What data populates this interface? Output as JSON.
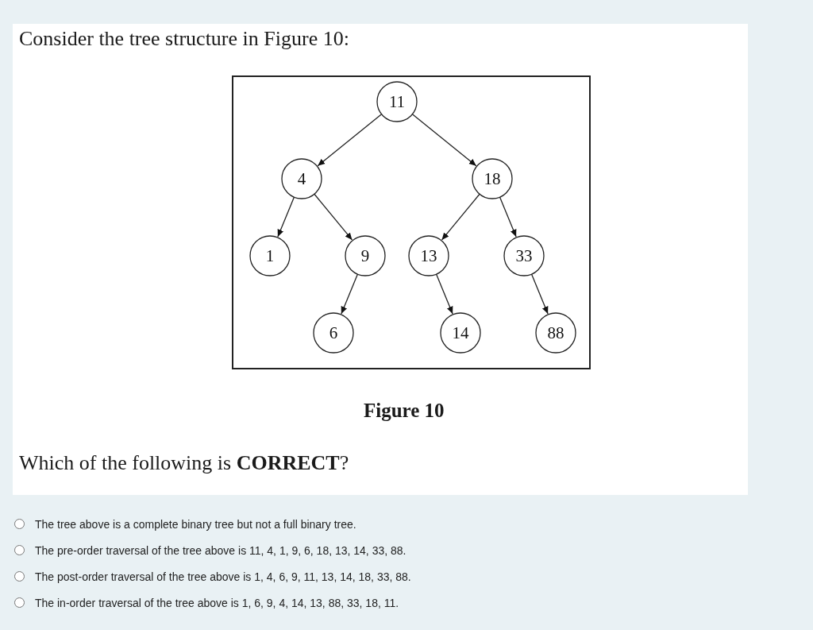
{
  "question": {
    "intro": "Consider the tree structure in Figure 10:",
    "figure": {
      "tree": {
        "label": "11",
        "children": [
          {
            "label": "4",
            "kind": "left",
            "children": [
              {
                "label": "1",
                "kind": "left"
              },
              {
                "label": "9",
                "kind": "right",
                "children": [
                  {
                    "label": "6",
                    "kind": "left"
                  }
                ]
              }
            ]
          },
          {
            "label": "18",
            "kind": "right",
            "children": [
              {
                "label": "13",
                "kind": "left",
                "children": [
                  {
                    "label": "14",
                    "kind": "right"
                  }
                ]
              },
              {
                "label": "33",
                "kind": "right",
                "children": [
                  {
                    "label": "88",
                    "kind": "right"
                  }
                ]
              }
            ]
          }
        ]
      },
      "caption": "Figure 10"
    },
    "prompt": "Which of the following is **CORRECT**?"
  },
  "options": [
    {
      "label": "The tree above is a complete binary tree but not a full binary tree.",
      "selected": false
    },
    {
      "label": "The pre-order traversal of the tree above is 11, 4, 1, 9, 6, 18, 13, 14, 33, 88.",
      "selected": false
    },
    {
      "label": "The post-order traversal of the tree above is 1, 4, 6, 9, 11, 13, 14, 18, 33, 88.",
      "selected": false
    },
    {
      "label": "The in-order traversal of the tree above is 1, 6, 9, 4, 14, 13, 88, 33, 18, 11.",
      "selected": false
    }
  ]
}
